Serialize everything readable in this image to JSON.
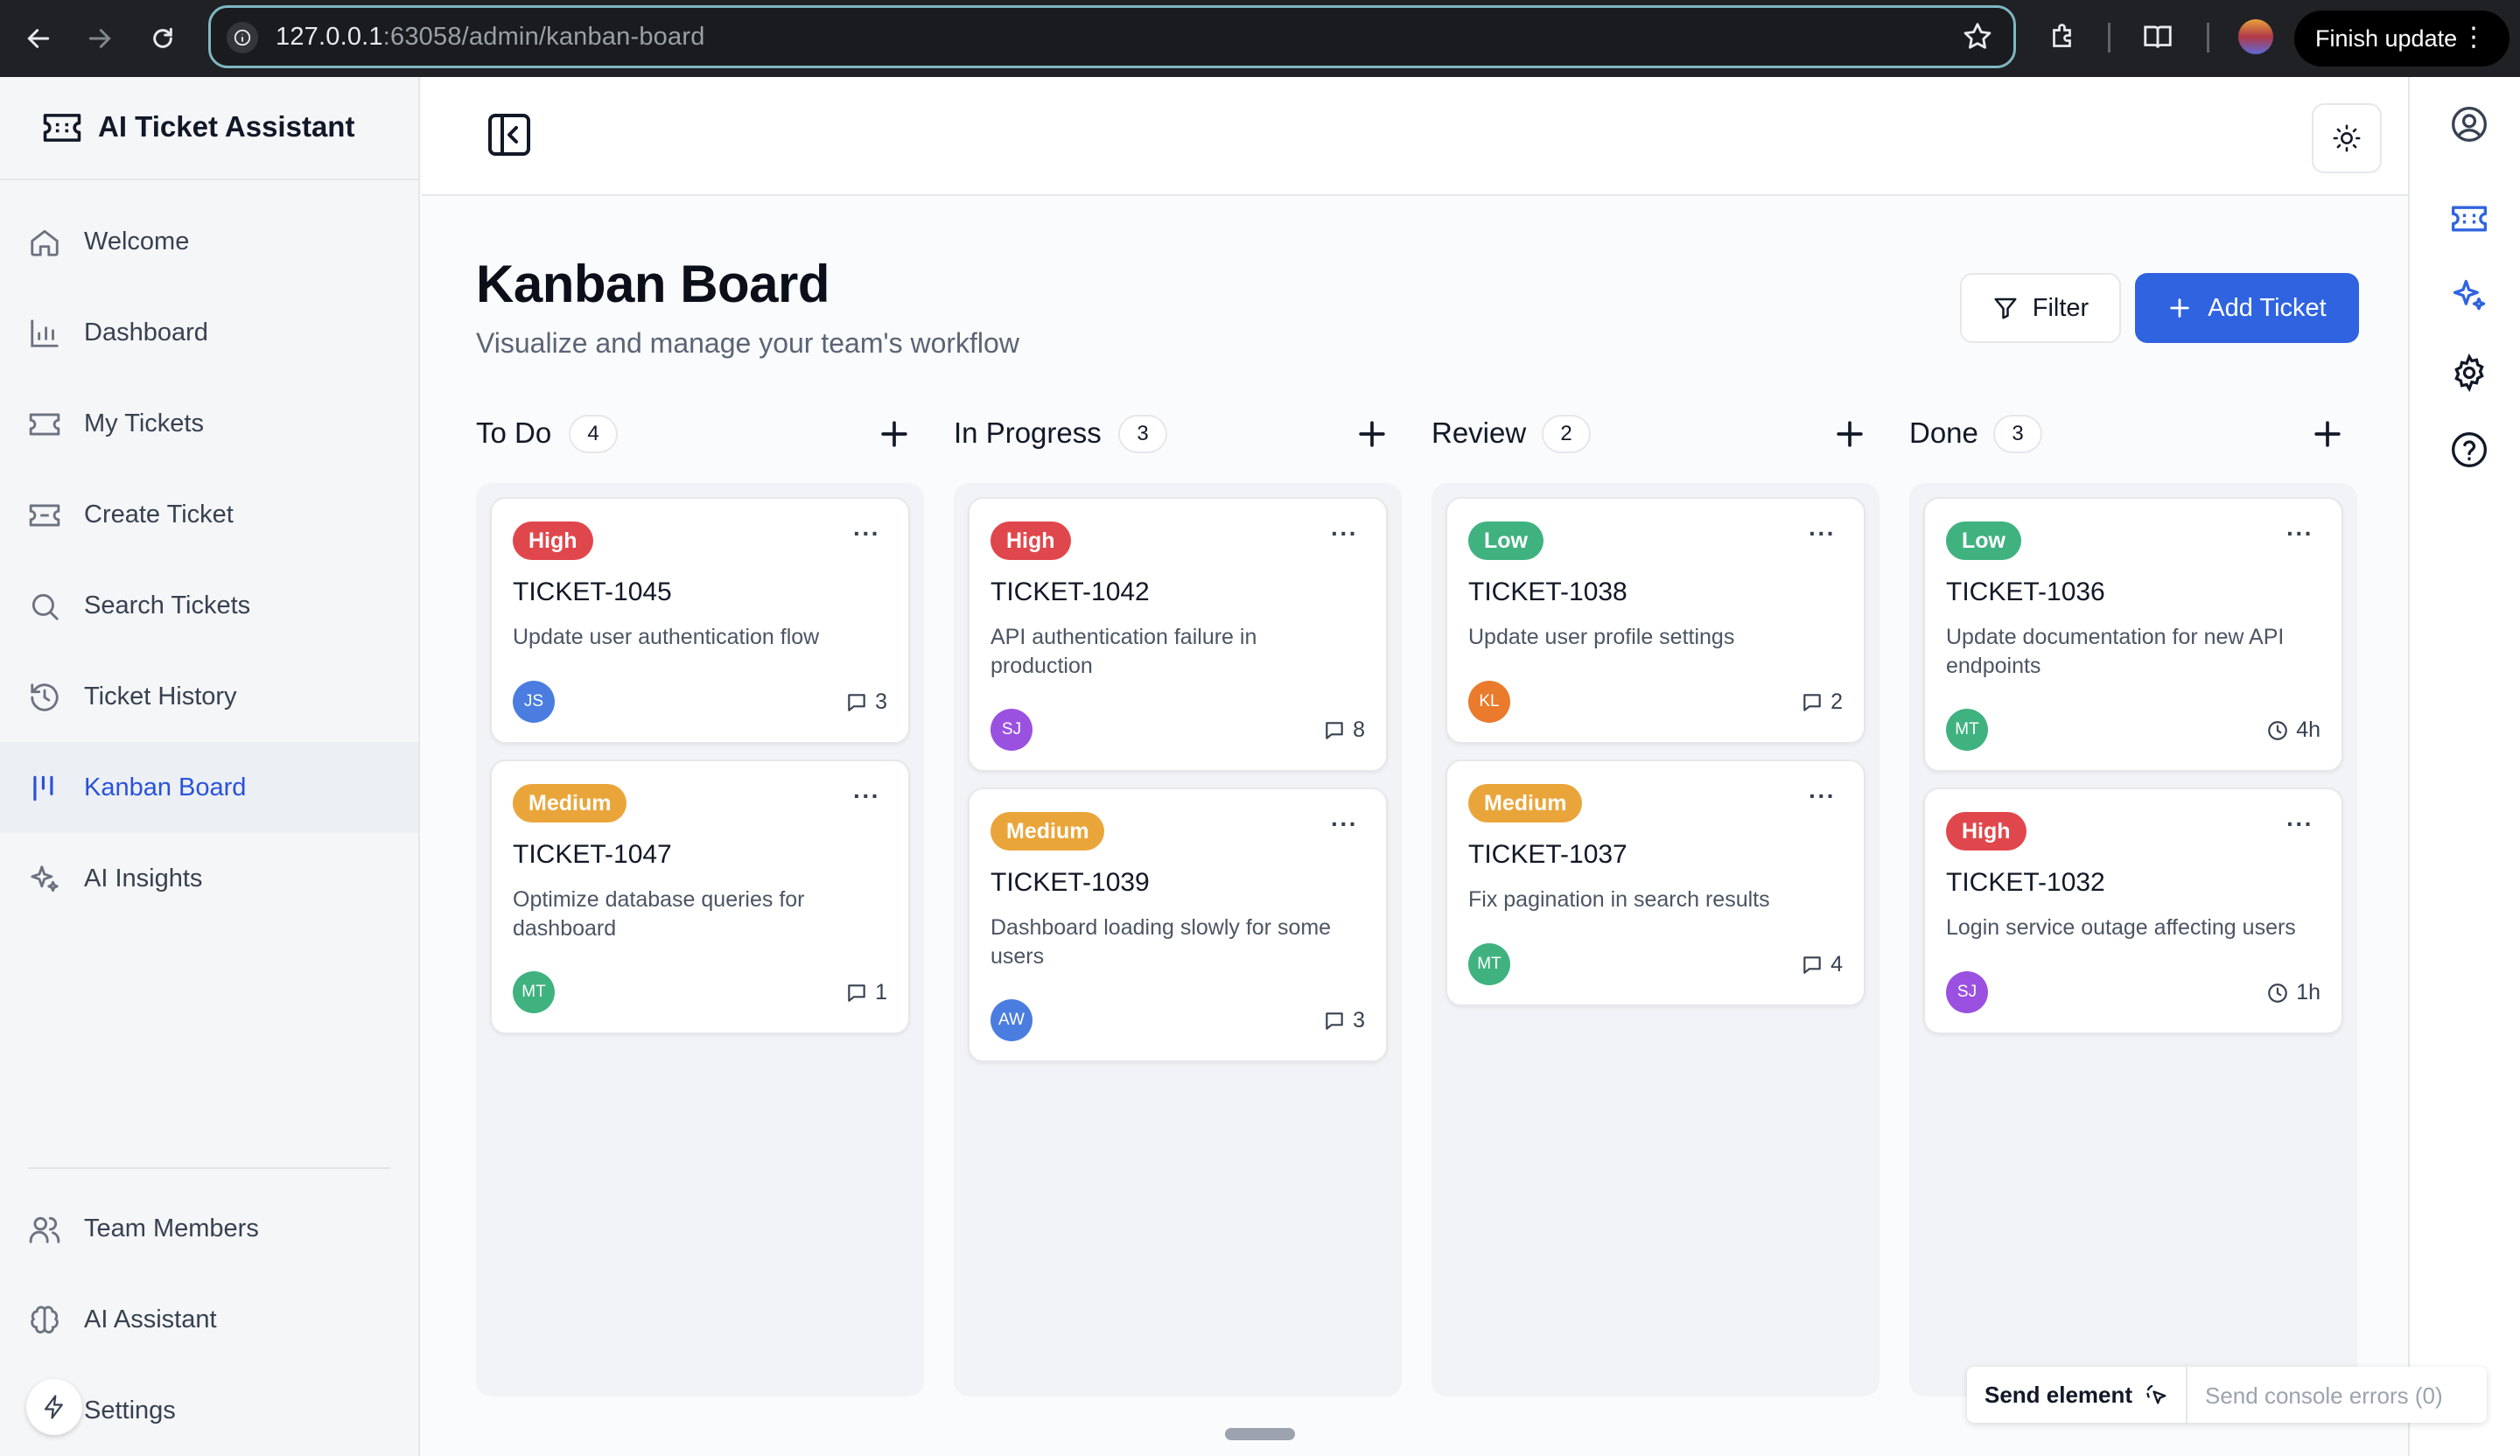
{
  "browser": {
    "url_host": "127.0.0.1",
    "url_rest": ":63058/admin/kanban-board",
    "finish_update": "Finish update"
  },
  "sidebar": {
    "brand": "AI Ticket Assistant",
    "items": [
      {
        "label": "Welcome",
        "icon": "home-icon"
      },
      {
        "label": "Dashboard",
        "icon": "bar-chart-icon"
      },
      {
        "label": "My Tickets",
        "icon": "ticket-icon"
      },
      {
        "label": "Create Ticket",
        "icon": "ticket-plus-icon"
      },
      {
        "label": "Search Tickets",
        "icon": "search-icon"
      },
      {
        "label": "Ticket History",
        "icon": "history-icon"
      },
      {
        "label": "Kanban Board",
        "icon": "kanban-icon",
        "active": true
      },
      {
        "label": "AI Insights",
        "icon": "sparkles-icon"
      }
    ],
    "bottom_items": [
      {
        "label": "Team Members",
        "icon": "users-icon"
      },
      {
        "label": "AI Assistant",
        "icon": "brain-icon"
      },
      {
        "label": "Settings",
        "icon": "settings-icon"
      }
    ]
  },
  "page": {
    "title": "Kanban Board",
    "subtitle": "Visualize and manage your team's workflow",
    "filter_label": "Filter",
    "add_label": "Add Ticket"
  },
  "colors": {
    "high": "#e0474c",
    "medium": "#eaa53a",
    "low": "#3fb27f",
    "accent": "#2f63e0"
  },
  "columns": [
    {
      "title": "To Do",
      "count": "4",
      "cards": [
        {
          "priority": "High",
          "id": "TICKET-1045",
          "desc": "Update user authentication flow",
          "avatar": "JS",
          "meta_icon": "comment-icon",
          "meta": "3"
        },
        {
          "priority": "Medium",
          "id": "TICKET-1047",
          "desc": "Optimize database queries for dashboard",
          "avatar": "MT",
          "meta_icon": "comment-icon",
          "meta": "1"
        }
      ]
    },
    {
      "title": "In Progress",
      "count": "3",
      "cards": [
        {
          "priority": "High",
          "id": "TICKET-1042",
          "desc": "API authentication failure in production",
          "avatar": "SJ",
          "meta_icon": "comment-icon",
          "meta": "8"
        },
        {
          "priority": "Medium",
          "id": "TICKET-1039",
          "desc": "Dashboard loading slowly for some users",
          "avatar": "AW",
          "meta_icon": "comment-icon",
          "meta": "3"
        }
      ]
    },
    {
      "title": "Review",
      "count": "2",
      "cards": [
        {
          "priority": "Low",
          "id": "TICKET-1038",
          "desc": "Update user profile settings",
          "avatar": "KL",
          "meta_icon": "comment-icon",
          "meta": "2"
        },
        {
          "priority": "Medium",
          "id": "TICKET-1037",
          "desc": "Fix pagination in search results",
          "avatar": "MT",
          "meta_icon": "comment-icon",
          "meta": "4"
        }
      ]
    },
    {
      "title": "Done",
      "count": "3",
      "cards": [
        {
          "priority": "Low",
          "id": "TICKET-1036",
          "desc": "Update documentation for new API endpoints",
          "avatar": "MT",
          "meta_icon": "clock-icon",
          "meta": "4h"
        },
        {
          "priority": "High",
          "id": "TICKET-1032",
          "desc": "Login service outage affecting users",
          "avatar": "SJ",
          "meta_icon": "clock-icon",
          "meta": "1h"
        }
      ]
    }
  ],
  "devtools": {
    "send_element": "Send element",
    "send_errors": "Send console errors (0)"
  }
}
